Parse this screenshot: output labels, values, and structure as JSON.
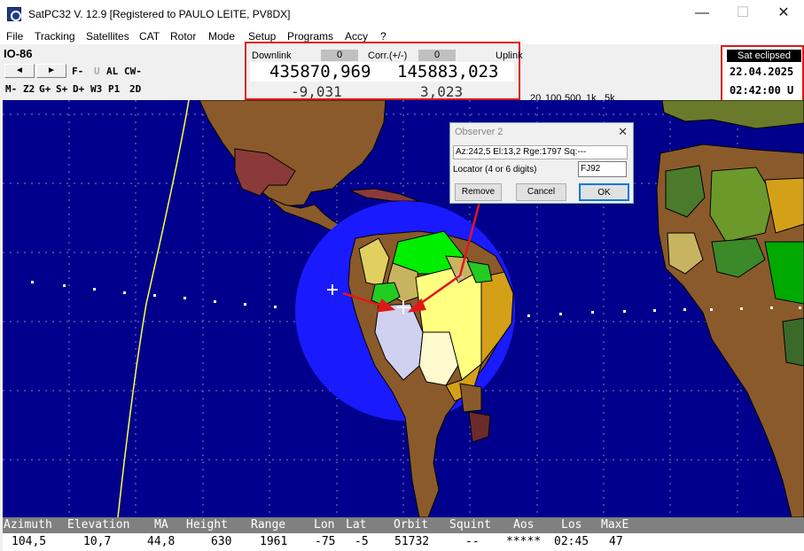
{
  "window": {
    "title": "SatPC32 V. 12.9   [Registered to PAULO LEITE, PV8DX]",
    "minimize": "—",
    "maximize": "☐",
    "close": "✕"
  },
  "menu": [
    "File",
    "Tracking",
    "Satellites",
    "CAT",
    "Rotor",
    "Mode",
    "Setup",
    "Programs",
    "Accy",
    "?"
  ],
  "toolbar": {
    "satellite": "IO-86",
    "prev": "◄",
    "next": "►",
    "row1": [
      "F-",
      "U",
      "AL",
      "CW-"
    ],
    "row2": [
      "M-",
      "Z2",
      "G+",
      "S+",
      "D+",
      "W3",
      "P1",
      "2D"
    ]
  },
  "frequency": {
    "downlink_label": "Downlink",
    "downlink_indicator": "0",
    "corr_label": "Corr.(+/-)",
    "corr_indicator": "0",
    "uplink_label": "Uplink",
    "downlink_freq": "435870,969",
    "uplink_freq": "145883,023",
    "downlink_doppler": "-9,031",
    "uplink_doppler": "3,023"
  },
  "steps": {
    "labels": [
      "20",
      "100",
      "500",
      "1k",
      "5k"
    ],
    "up": "▲",
    "down": "▼"
  },
  "eclipse": {
    "status": "Sat eclipsed",
    "date": "22.04.2025",
    "time": "02:42:00 U"
  },
  "observer_dialog": {
    "title": "Observer 2",
    "close": "✕",
    "info": "Az:242,5  El:13,2  Rge:1797  Sq:---",
    "locator_label": "Locator (4 or 6 digits)",
    "locator_value": "FJ92",
    "remove": "Remove",
    "cancel": "Cancel",
    "ok": "OK"
  },
  "status": {
    "headers": [
      "Azimuth",
      "Elevation",
      "MA",
      "Height",
      "Range",
      "Lon",
      "Lat",
      "Orbit",
      "Squint",
      "Aos",
      "Los",
      "MaxE"
    ],
    "values": [
      "104,5",
      "10,7",
      "44,8",
      "630",
      "1961",
      "-75",
      "-5",
      "51732",
      "--",
      "*****",
      "02:45",
      "47"
    ]
  },
  "colors": {
    "ocean": "#00008c",
    "footprint": "#1a1aff",
    "highlight_box": "#e01818",
    "arrow": "#e01818",
    "ground_track": "#ffff40"
  }
}
